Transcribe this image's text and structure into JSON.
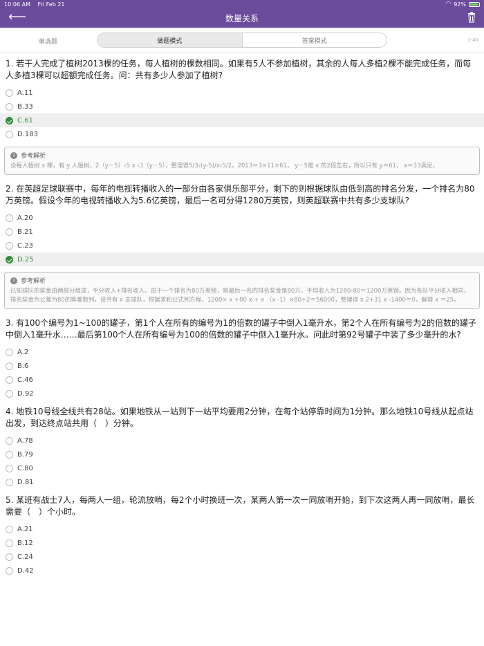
{
  "status": {
    "time": "10:06 AM",
    "date": "Fri Feb 21",
    "battery": "92%"
  },
  "nav": {
    "title": "数量关系"
  },
  "mode": {
    "type_label": "单选题",
    "tab_practice": "做题模式",
    "tab_answer": "答案模式",
    "range": "1-40"
  },
  "explain_label": "参考解析",
  "questions": [
    {
      "text": "1. 若干人完成了植树2013棵的任务，每人植树的棵数相同。如果有5人不参加植树，其余的人每人多植2棵不能完成任务，而每人多植3棵可以超额完成任务。问：共有多少人参加了植树?",
      "options": [
        "A.11",
        "B.33",
        "C.61",
        "D.183"
      ],
      "correct": 2,
      "explanation": "设每人植树 x 棵，有 y 人植树，2（y－5）‹5 x ‹3（y－5），整理得5/3‹(y-5)/x‹5/2。2013＝3×11×61， y－5是 x 的2倍左右，所以只有 y＝61， x＝33满足。"
    },
    {
      "text": "2. 在英超足球联赛中，每年的电视转播收入的一部分由各家俱乐部平分，剩下的则根据球队由低到高的排名分发，一个排名为80万英镑。假设今年的电视转播收入为5.6亿英镑，最后一名可分得1280万英镑，则英超联赛中共有多少支球队?",
      "options": [
        "A.20",
        "B.21",
        "C.23",
        "D.25"
      ],
      "correct": 3,
      "explanation": "已知球队的奖金由两部分组成，平分收入+排名收入。由于一个排名为80万英镑，则最后一名的排名奖金是80万，平均收入为1280-80＝1200万英镑。因为各队平分收入相同，排名奖金为公差为80的等差数列，设共有 x 支球队，根据求和公式列方程。1200× x +80 x + x （x -1）×80÷2＝56000，整理得 x 2+31 x -1400＝0，解得 x ＝25。"
    },
    {
      "text": "3. 有100个编号为1~100的罐子，第1个人在所有的编号为1的倍数的罐子中倒入1毫升水，第2个人在所有编号为2的倍数的罐子中倒入1毫升水……最后第100个人在所有编号为100的倍数的罐子中倒入1毫升水。问此时第92号罐子中装了多少毫升的水?",
      "options": [
        "A.2",
        "B.6",
        "C.46",
        "D.92"
      ],
      "correct": -1,
      "explanation": ""
    },
    {
      "text": "4. 地铁10号线全线共有28站。如果地铁从一站到下一站平均要用2分钟，在每个站停靠时间为1分钟。那么地铁10号线从起点站出发，到达终点站共用（　）分钟。",
      "options": [
        "A.78",
        "B.79",
        "C.80",
        "D.81"
      ],
      "correct": -1,
      "explanation": ""
    },
    {
      "text": "5. 某班有战士7人，每两人一组，轮流放哨，每2个小时换班一次，某两人第一次一同放哨开始，到下次这两人再一同放哨，最长需要（　）个小时。",
      "options": [
        "A.21",
        "B.12",
        "C.24",
        "D.42"
      ],
      "correct": -1,
      "explanation": ""
    }
  ]
}
